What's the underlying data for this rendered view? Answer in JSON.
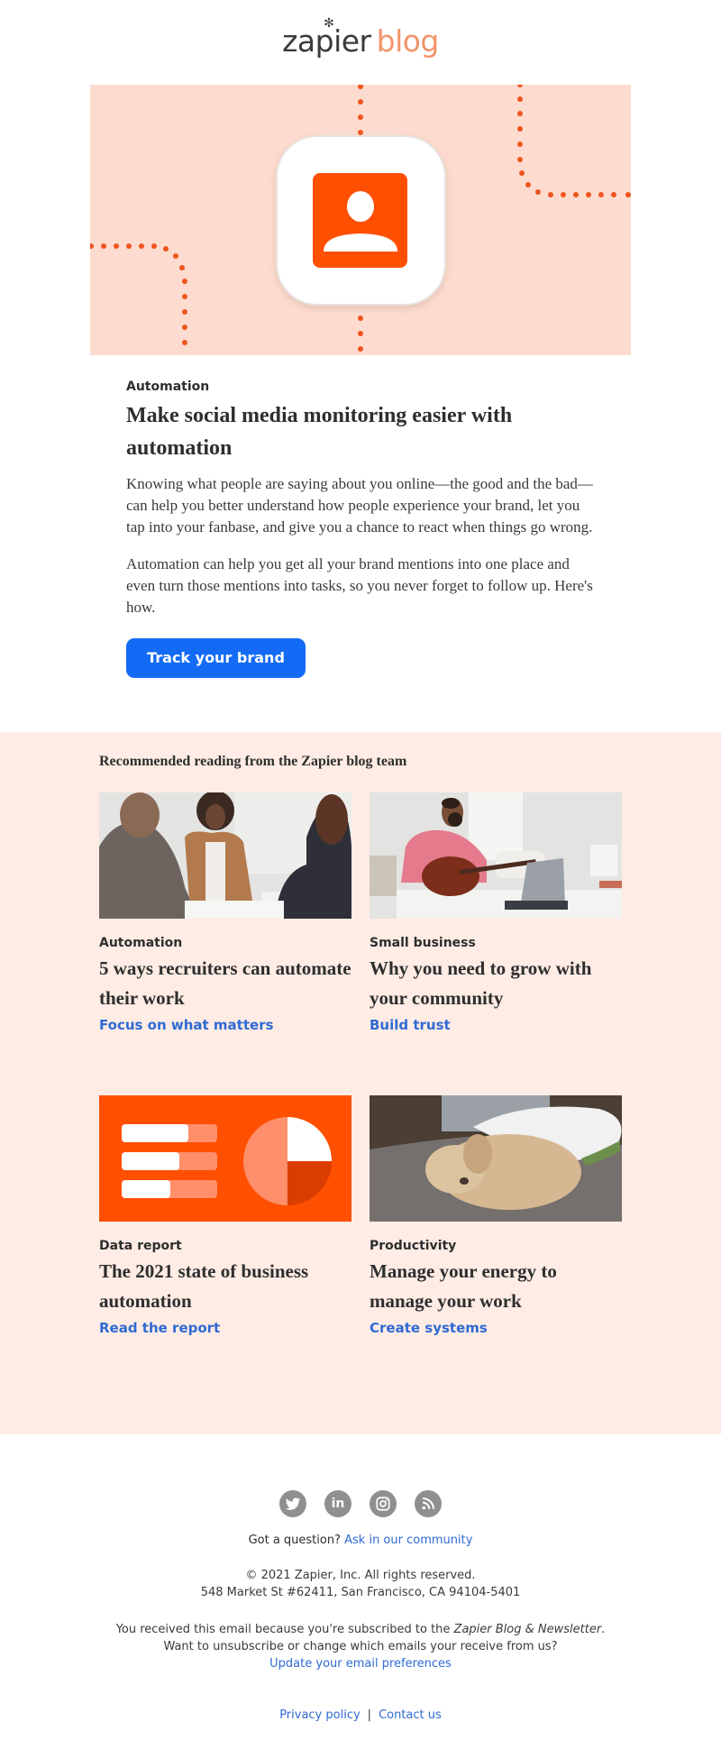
{
  "header": {
    "logo_primary": "zapier",
    "logo_secondary": "blog",
    "logo_star": "✻"
  },
  "hero": {
    "icon": "person-contact-icon",
    "colors": {
      "background": "#fddccf",
      "accent": "#ff4f00",
      "dots": "#f0541e"
    }
  },
  "article": {
    "category": "Automation",
    "title": "Make social media monitoring easier with automation",
    "paragraphs": [
      "Knowing what people are saying about you online—the good and the bad—can help you better understand how people experience your brand, let you tap into your fanbase, and give you a chance to react when things go wrong.",
      "Automation can help you get all your brand mentions into one place and even turn those mentions into tasks, so you never forget to follow up. Here's how."
    ],
    "cta_label": "Track your brand",
    "cta_color": "#136bf5"
  },
  "recommended": {
    "heading": "Recommended reading from the Zapier blog team",
    "background": "#ffece5",
    "cards": [
      {
        "image": "recruiters-handshake-photo",
        "category": "Automation",
        "title": "5 ways recruiters can automate their work",
        "link": "Focus on what matters"
      },
      {
        "image": "man-guitar-laptop-photo",
        "category": "Small business",
        "title": "Why you need to grow with your community",
        "link": "Build trust"
      },
      {
        "image": "data-report-illustration",
        "category": "Data report",
        "title": "The 2021 state of business automation",
        "link": "Read the report"
      },
      {
        "image": "sleeping-dog-photo",
        "category": "Productivity",
        "title": "Manage your energy to manage your work",
        "link": "Create systems"
      }
    ]
  },
  "footer": {
    "socials": [
      {
        "name": "twitter-icon"
      },
      {
        "name": "linkedin-icon"
      },
      {
        "name": "instagram-icon"
      },
      {
        "name": "rss-icon"
      }
    ],
    "question": "Got a question?",
    "community_link": "Ask in our community",
    "copyright": "© 2021 Zapier, Inc. All rights reserved.",
    "address": "548 Market St #62411, San Francisco, CA 94104-5401",
    "subscribed_prefix": "You received this email because you're subscribed to the ",
    "subscribed_list": "Zapier Blog & Newsletter",
    "subscribed_suffix": ".",
    "unsubscribe_text": "Want to unsubscribe or change which emails your receive from us?",
    "preferences_link": "Update your email preferences",
    "privacy_link": "Privacy policy",
    "separator": "|",
    "contact_link": "Contact us"
  }
}
